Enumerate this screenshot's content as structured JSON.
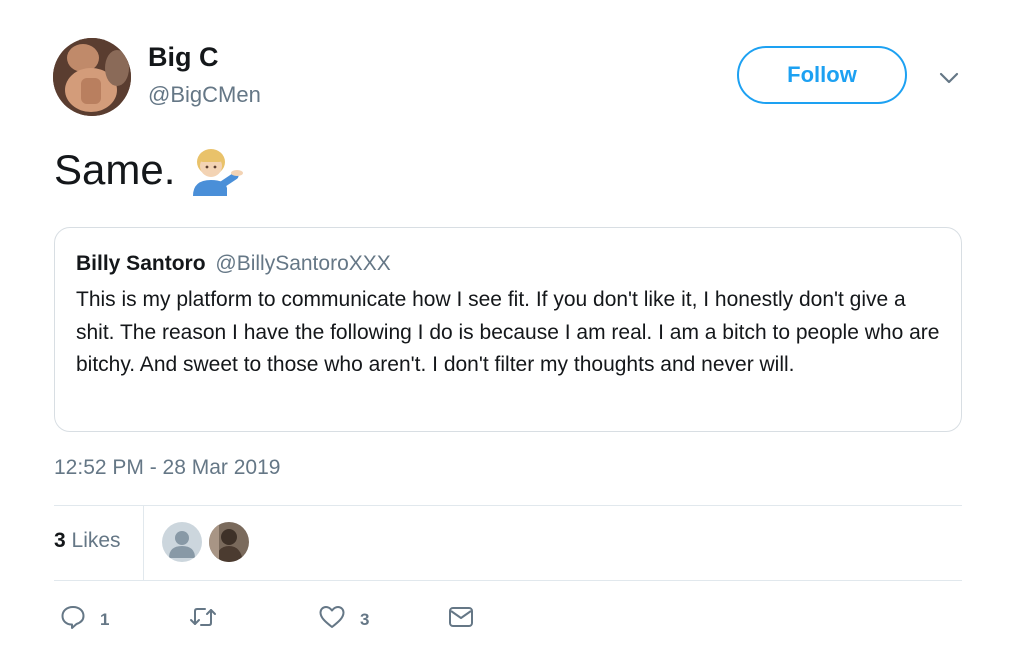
{
  "user": {
    "display_name": "Big C",
    "handle": "@BigCMen",
    "follow_label": "Follow"
  },
  "tweet": {
    "text": "Same.",
    "emoji": "person-tipping-hand-emoji"
  },
  "quoted": {
    "name": "Billy Santoro",
    "handle": "@BillySantoroXXX",
    "text": "This is my platform to communicate how I see fit.  If you don't like it, I honestly don't give a shit. The reason I have the following I do is because I am real.  I am a bitch to people who are bitchy. And sweet to those who aren't. I don't filter my thoughts and never will."
  },
  "timestamp": "12:52 PM - 28 Mar 2019",
  "stats": {
    "likes_count": "3",
    "likes_label": "Likes"
  },
  "actions": {
    "reply_count": "1",
    "retweet_count": "",
    "like_count": "3"
  },
  "colors": {
    "accent": "#1da1f2",
    "secondary_text": "#657786",
    "border": "#e1e8ed"
  }
}
